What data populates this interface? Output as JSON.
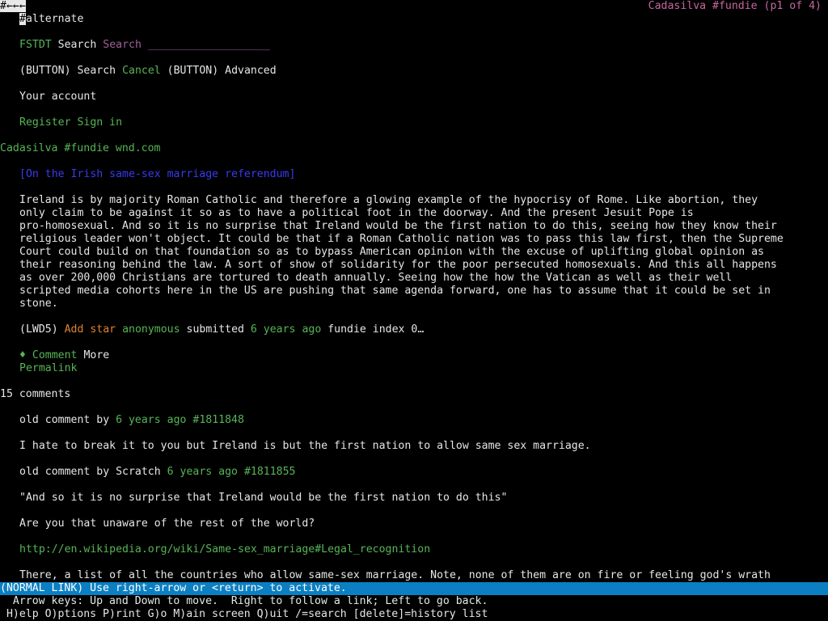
{
  "browser": {
    "back_marker": "#←←←",
    "page_title": "Cadasilva #fundie (p1 of 4)"
  },
  "header": {
    "alternate_hash": "#",
    "alternate_text": "alternate",
    "site_link": "FSTDT",
    "search_label": "Search",
    "search_input": "Search ___________________",
    "button1": "(BUTTON)",
    "search_button": "Search",
    "cancel_link": "Cancel",
    "button2": "(BUTTON)",
    "advanced_label": "Advanced",
    "your_account": "Your account",
    "register_link": "Register",
    "signin_link": "Sign in"
  },
  "post": {
    "heading": "Cadasilva #fundie wnd.com",
    "title_link": "[On the Irish same-sex marriage referendum]",
    "body_lines": [
      "Ireland is by majority Roman Catholic and therefore a glowing example of the hypocrisy of Rome. Like abortion, they",
      "only claim to be against it so as to have a political foot in the doorway. And the present Jesuit Pope is",
      "pro-homosexual. And so it is no surprise that Ireland would be the first nation to do this, seeing how they know their",
      "religious leader won't object. It could be that if a Roman Catholic nation was to pass this law first, then the Supreme",
      "Court could build on that foundation so as to bypass American opinion with the excuse of uplifting global opinion as",
      "their reasoning behind the law. A sort of show of solidarity for the poor persecuted homosexuals. And this all happens",
      "as over 200,000 Christians are tortured to death annually. Seeing how the how the Vatican as well as their well",
      "scripted media cohorts here in the US are pushing that same agenda forward, one has to assume that it could be set in",
      "stone."
    ],
    "meta": {
      "code": "(LWD5)",
      "add_star": "Add star",
      "author": "anonymous",
      "submitted": "submitted",
      "age": "6 years ago",
      "index": "fundie index 0…"
    },
    "comment_bullet": "♦",
    "comment_link": "Comment",
    "more_label": "More",
    "permalink": "Permalink"
  },
  "comments": {
    "count": "15 comments",
    "items": [
      {
        "prefix": "old comment by",
        "author": "",
        "age": "6 years ago",
        "id": "#1811848",
        "text": "I hate to break it to you but Ireland is but the first nation to allow same sex marriage."
      },
      {
        "prefix": "old comment by",
        "author": "Scratch",
        "age": "6 years ago",
        "id": "#1811855",
        "text": "\"And so it is no surprise that Ireland would be the first nation to do this\"",
        "text2": "Are you that unaware of the rest of the world?",
        "url": "http://en.wikipedia.org/wiki/Same-sex_marriage#Legal_recognition",
        "text3": "There, a list of all the countries who allow same-sex marriage. Note, none of them are on fire or feeling god's wrath"
      }
    ]
  },
  "status": {
    "bar": "(NORMAL LINK) Use right-arrow or <return> to activate.",
    "help1": "  Arrow keys: Up and Down to move.  Right to follow a link; Left to go back.",
    "help2": " H)elp O)ptions P)rint G)o M)ain screen Q)uit /=search [delete]=history list"
  },
  "colors": {
    "background": "#000000",
    "text": "#e6e6e6",
    "link": "#56b556",
    "input": "#a15f9a",
    "title": "#c4689f",
    "heading_link": "#3a3af2",
    "star": "#e0822f",
    "status_bar": "#0b7fc2"
  }
}
